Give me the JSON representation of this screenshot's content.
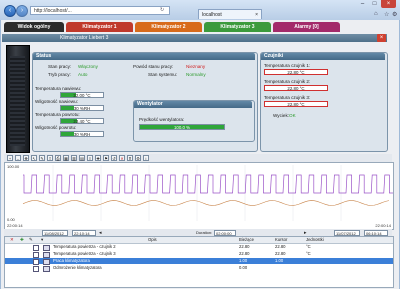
{
  "browser": {
    "address": "http://localhost/...",
    "tab_label": "localhost",
    "controls": [
      "minimize",
      "maximize",
      "close"
    ]
  },
  "nav_tabs": [
    {
      "label": "Widok ogólny",
      "color": "#2b2b2b"
    },
    {
      "label": "Klimatyzator 1",
      "color": "#c0392b"
    },
    {
      "label": "Klimatyzator 2",
      "color": "#d86a1a"
    },
    {
      "label": "Klimatyzator 3",
      "color": "#3c9a3c"
    },
    {
      "label": "Alarmy [0]",
      "color": "#a32a6a"
    }
  ],
  "page_title": "Klimatyzator Liebert 3",
  "status_panel": {
    "title": "Status",
    "stan_pracy_label": "Stan pracy:",
    "stan_pracy_value": "Włączony",
    "tryb_pracy_label": "Tryb pracy:",
    "tryb_pracy_value": "Auto",
    "powod_label": "Powód stanu pracy:",
    "powod_value": "Nieznany",
    "stan_systemu_label": "Stan systemu:",
    "stan_systemu_value": "Normalny",
    "temp_nawiewu_label": "Temperatura nawiewu:",
    "temp_nawiewu_value": "22.00 °C",
    "temp_nawiewu_fill": 0.35,
    "wilg_nawiewu_label": "Wilgotność nawiewu:",
    "wilg_nawiewu_value": "30 %RH",
    "wilg_nawiewu_fill": 0.3,
    "temp_powrotu_label": "Temperatura powrotu:",
    "temp_powrotu_value": "23.40 °C",
    "temp_powrotu_fill": 0.38,
    "wilg_powrotu_label": "Wilgotność powrotu:",
    "wilg_powrotu_value": "30 %RH",
    "wilg_powrotu_fill": 0.3
  },
  "wentylator_panel": {
    "title": "Wentylator",
    "predkosc_label": "Prędkość wentylatora:",
    "predkosc_value": "100.0 %",
    "predkosc_fill": 1.0
  },
  "czujniki_panel": {
    "title": "Czujniki",
    "s1_label": "Temperatura czujnik 1:",
    "s1_value": "22.80 °C",
    "s2_label": "Temperatura czujnik 2:",
    "s2_value": "22.80 °C",
    "s3_label": "Temperatura czujnik 3:",
    "s3_value": "22.80 °C",
    "wyciek_label": "Wyciek:",
    "wyciek_value": "OK"
  },
  "chart": {
    "y_top": "100.00",
    "y_bottom": "0.00",
    "time_left": "22:00:14",
    "time_right": "22:00:14"
  },
  "controls": {
    "date_from": "11/08/2012",
    "time_from": "22:10:14",
    "duration_label": "Duration:",
    "duration_value": "02:00:00",
    "date_to": "11/07/2012",
    "time_to": "06:10:14"
  },
  "table": {
    "headers": [
      "Opis",
      "Bieżące",
      "Kursor",
      "Jednostki"
    ],
    "rows": [
      {
        "opis": "Temperatura powietrza - czujnik 2",
        "biezace": "22.80",
        "kursor": "22.80",
        "jednostki": "°C",
        "selected": false
      },
      {
        "opis": "Temperatura powietrza - czujnik 3",
        "biezace": "22.80",
        "kursor": "22.80",
        "jednostki": "°C",
        "selected": false
      },
      {
        "opis": "Praca klimatyzatora",
        "biezace": "1.00",
        "kursor": "1.00",
        "jednostki": "",
        "selected": true
      },
      {
        "opis": "Odmrożenie klimatyzatora",
        "biezace": "0.00",
        "kursor": "",
        "jednostki": "",
        "selected": false
      }
    ]
  },
  "colors": {
    "accent_green": "#2fa63a",
    "status_green": "#2a9a2a",
    "status_red": "#d02020",
    "chart_line_purple": "#9b54c8",
    "chart_line_orange": "#c8844a"
  }
}
